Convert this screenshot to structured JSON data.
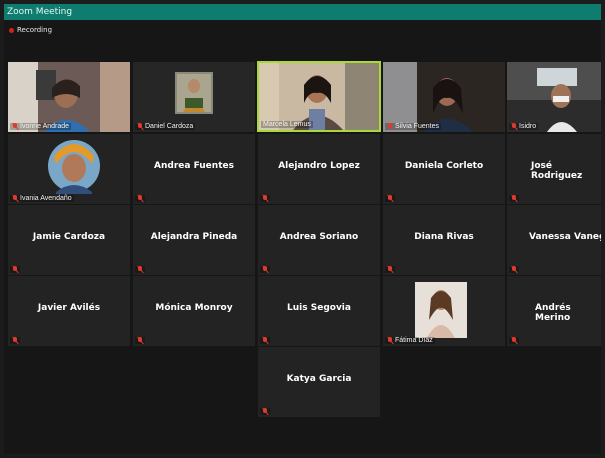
{
  "window": {
    "title": "Zoom Meeting"
  },
  "recording": {
    "label": "Recording"
  },
  "participants": [
    {
      "name": "Ivonne Andrade",
      "video": true,
      "mic_muted": true
    },
    {
      "name": "Daniel Cardoza",
      "video": true,
      "mic_muted": true
    },
    {
      "name": "Marcela Lemus",
      "video": true,
      "mic_muted": false,
      "active_speaker": true
    },
    {
      "name": "Silvia Fuentes",
      "video": true,
      "mic_muted": true
    },
    {
      "name": "Isidro",
      "video": true,
      "mic_muted": true
    },
    {
      "name": "Ivania Avendaño",
      "video": true,
      "mic_muted": true
    },
    {
      "name": "Andrea Fuentes",
      "video": false,
      "mic_muted": true
    },
    {
      "name": "Alejandro Lopez",
      "video": false,
      "mic_muted": true
    },
    {
      "name": "Daniela Corleto",
      "video": false,
      "mic_muted": true
    },
    {
      "name": "José Rodriguez",
      "video": false,
      "mic_muted": true
    },
    {
      "name": "Jamie Cardoza",
      "video": false,
      "mic_muted": true
    },
    {
      "name": "Alejandra Pineda",
      "video": false,
      "mic_muted": true
    },
    {
      "name": "Andrea Soriano",
      "video": false,
      "mic_muted": true
    },
    {
      "name": "Diana Rivas",
      "video": false,
      "mic_muted": true
    },
    {
      "name": "Vanessa Vanegas",
      "video": false,
      "mic_muted": true
    },
    {
      "name": "Javier Avilés",
      "video": false,
      "mic_muted": true
    },
    {
      "name": "Mónica Monroy",
      "video": false,
      "mic_muted": true
    },
    {
      "name": "Luis Segovia",
      "video": false,
      "mic_muted": true
    },
    {
      "name": "Fátima Díaz",
      "video": true,
      "mic_muted": true
    },
    {
      "name": "Andrés Merino",
      "video": false,
      "mic_muted": true
    },
    {
      "name": "Katya Garcia",
      "video": false,
      "mic_muted": true
    }
  ],
  "colors": {
    "title_bar": "#0e7d6f",
    "active_speaker_border": "#a9d83a",
    "muted_mic": "#e03a2e",
    "tile_bg": "#232323"
  }
}
